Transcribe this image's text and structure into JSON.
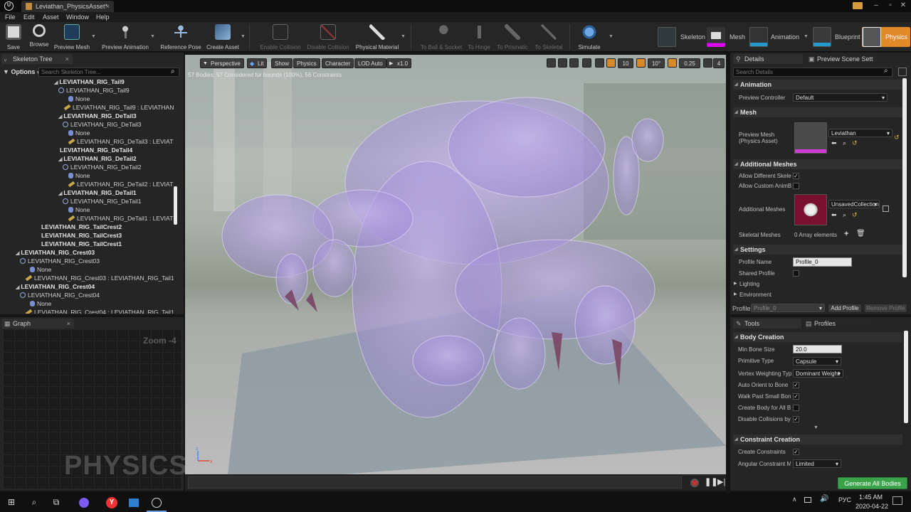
{
  "window": {
    "tab_title": "Leviathan_PhysicsAsset*"
  },
  "menu": [
    "File",
    "Edit",
    "Asset",
    "Window",
    "Help"
  ],
  "toolbar": {
    "save": "Save",
    "browse": "Browse",
    "preview_mesh": "Preview Mesh",
    "preview_animation": "Preview Animation",
    "reference_pose": "Reference Pose",
    "create_asset": "Create Asset",
    "enable_collision": "Enable Collision",
    "disable_collision": "Disable Collision",
    "physical_material": "Physical Material",
    "to_ball_socket": "To Ball & Socket",
    "to_hinge": "To Hinge",
    "to_prismatic": "To Prismatic",
    "to_skeletal": "To Skeletal",
    "simulate": "Simulate"
  },
  "modes": [
    "Skeleton",
    "Mesh",
    "Animation",
    "Blueprint",
    "Physics"
  ],
  "skeleton_tree": {
    "tab": "Skeleton Tree",
    "options": "Options",
    "search_placeholder": "Search Skeleton Tree...",
    "rows": [
      {
        "text": "LEVIATHAN_RIG_Tail9",
        "kind": "bold",
        "indent": 76
      },
      {
        "text": "LEVIATHAN_RIG_Tail9",
        "kind": "body",
        "indent": 82
      },
      {
        "text": "None",
        "kind": "none",
        "indent": 96
      },
      {
        "text": "LEVIATHAN_RIG_Tail9 : LEVIATHAN_F",
        "kind": "cons",
        "indent": 90
      },
      {
        "text": "LEVIATHAN_RIG_DeTail3",
        "kind": "bold",
        "indent": 82
      },
      {
        "text": "LEVIATHAN_RIG_DeTail3",
        "kind": "body",
        "indent": 88
      },
      {
        "text": "None",
        "kind": "none",
        "indent": 96
      },
      {
        "text": "LEVIATHAN_RIG_DeTail3 : LEVIATH",
        "kind": "cons",
        "indent": 96
      },
      {
        "text": "LEVIATHAN_RIG_DeTail4",
        "kind": "boldleaf",
        "indent": 82
      },
      {
        "text": "LEVIATHAN_RIG_DeTail2",
        "kind": "bold",
        "indent": 82
      },
      {
        "text": "LEVIATHAN_RIG_DeTail2",
        "kind": "body",
        "indent": 88
      },
      {
        "text": "None",
        "kind": "none",
        "indent": 96
      },
      {
        "text": "LEVIATHAN_RIG_DeTail2 : LEVIATH",
        "kind": "cons",
        "indent": 96
      },
      {
        "text": "LEVIATHAN_RIG_DeTail1",
        "kind": "bold",
        "indent": 82
      },
      {
        "text": "LEVIATHAN_RIG_DeTail1",
        "kind": "body",
        "indent": 88
      },
      {
        "text": "None",
        "kind": "none",
        "indent": 96
      },
      {
        "text": "LEVIATHAN_RIG_DeTail1 : LEVIATH",
        "kind": "cons",
        "indent": 96
      },
      {
        "text": "LEVIATHAN_RIG_TailCrest2",
        "kind": "boldleaf",
        "indent": 56
      },
      {
        "text": "LEVIATHAN_RIG_TailCrest3",
        "kind": "boldleaf",
        "indent": 56
      },
      {
        "text": "LEVIATHAN_RIG_TailCrest1",
        "kind": "boldleaf",
        "indent": 56
      },
      {
        "text": "LEVIATHAN_RIG_Crest03",
        "kind": "bold",
        "indent": 22
      },
      {
        "text": "LEVIATHAN_RIG_Crest03",
        "kind": "body",
        "indent": 28
      },
      {
        "text": "None",
        "kind": "none",
        "indent": 42
      },
      {
        "text": "LEVIATHAN_RIG_Crest03 : LEVIATHAN_RIG_Tail1",
        "kind": "cons",
        "indent": 36
      },
      {
        "text": "LEVIATHAN_RIG_Crest04",
        "kind": "bold",
        "indent": 22
      },
      {
        "text": "LEVIATHAN_RIG_Crest04",
        "kind": "body",
        "indent": 28
      },
      {
        "text": "None",
        "kind": "none",
        "indent": 42
      },
      {
        "text": "LEVIATHAN_RIG_Crest04 : LEVIATHAN_RIG_Tail1",
        "kind": "cons",
        "indent": 36
      }
    ]
  },
  "graph": {
    "tab": "Graph",
    "zoom": "Zoom -4",
    "watermark": "PHYSICS"
  },
  "viewport": {
    "buttons": [
      "Perspective",
      "Lit",
      "Show",
      "Physics",
      "Character",
      "LOD Auto",
      "x1.0"
    ],
    "grid": "10",
    "angle": "10°",
    "scale": "0.25",
    "cam_speed": "4",
    "stats": "57 Bodies, 57 Considered for bounds (100%), 56 Constraints"
  },
  "details": {
    "tab": "Details",
    "tab2": "Preview Scene Sett",
    "search_placeholder": "Search Details",
    "animation": {
      "header": "Animation",
      "preview_controller": "Preview Controller",
      "preview_controller_value": "Default"
    },
    "mesh": {
      "header": "Mesh",
      "preview_mesh": "Preview Mesh",
      "preview_mesh_sub": "(Physics Asset)",
      "preview_mesh_value": "Leviathan"
    },
    "additional": {
      "header": "Additional Meshes",
      "allow_diff": "Allow Different Skelet",
      "allow_custom": "Allow Custom AnimBl",
      "additional_meshes": "Additional Meshes",
      "collection": "UnsavedCollection",
      "skeletal_meshes": "Skeletal Meshes",
      "array": "0 Array elements"
    },
    "settings": {
      "header": "Settings",
      "profile_name": "Profile Name",
      "profile_name_value": "Profile_0",
      "shared_profile": "Shared Profile",
      "lighting": "Lighting",
      "environment": "Environment"
    },
    "profile": {
      "label": "Profile",
      "value": "Profile_0",
      "add": "Add Profile",
      "remove": "Remove Profile"
    }
  },
  "tools": {
    "tab": "Tools",
    "tab2": "Profiles",
    "body_creation": "Body Creation",
    "min_bone_size": "Min Bone Size",
    "min_bone_size_value": "20.0",
    "primitive_type": "Primitive Type",
    "primitive_type_value": "Capsule",
    "vertex_weighting": "Vertex Weighting Type",
    "vertex_weighting_value": "Dominant Weight",
    "auto_orient": "Auto Orient to Bone",
    "walk_past": "Walk Past Small Bone",
    "create_body_all": "Create Body for All Bo",
    "disable_collisions": "Disable Collisions by D",
    "constraint_creation": "Constraint Creation",
    "create_constraints": "Create Constraints",
    "angular_constraint": "Angular Constraint Mo",
    "angular_constraint_value": "Limited",
    "generate": "Generate All Bodies"
  },
  "taskbar": {
    "lang": "РУС",
    "time": "1:45 AM",
    "date": "2020-04-22"
  }
}
